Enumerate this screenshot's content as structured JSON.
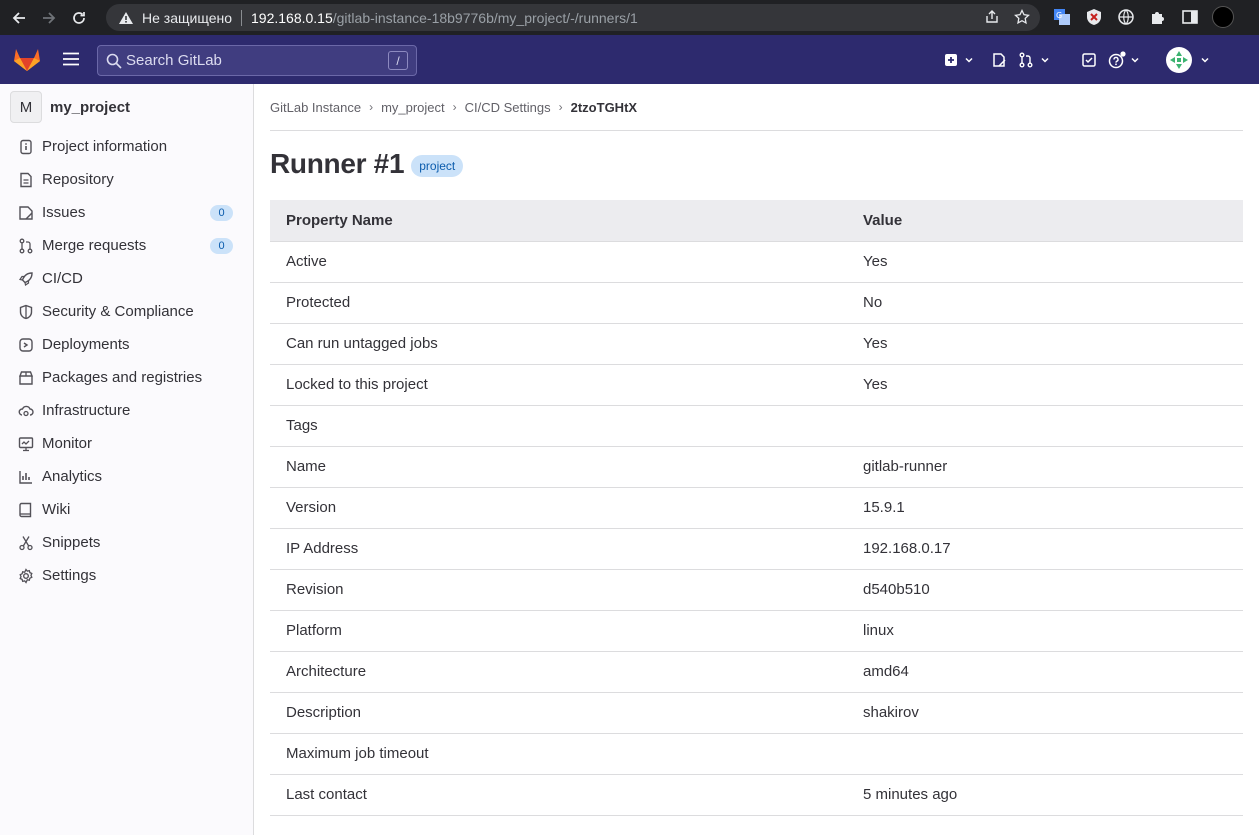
{
  "browser": {
    "not_secure": "Не защищено",
    "url_host": "192.168.0.15",
    "url_path": "/gitlab-instance-18b9776b/my_project/-/runners/1"
  },
  "header": {
    "search_placeholder": "Search GitLab",
    "search_shortcut": "/"
  },
  "sidebar": {
    "project_initial": "M",
    "project_name": "my_project",
    "items": [
      {
        "label": "Project information",
        "icon": "info-icon"
      },
      {
        "label": "Repository",
        "icon": "document-icon"
      },
      {
        "label": "Issues",
        "icon": "issues-icon",
        "count": "0"
      },
      {
        "label": "Merge requests",
        "icon": "merge-request-icon",
        "count": "0"
      },
      {
        "label": "CI/CD",
        "icon": "rocket-icon"
      },
      {
        "label": "Security & Compliance",
        "icon": "shield-icon"
      },
      {
        "label": "Deployments",
        "icon": "deployments-icon"
      },
      {
        "label": "Packages and registries",
        "icon": "package-icon"
      },
      {
        "label": "Infrastructure",
        "icon": "cloud-gear-icon"
      },
      {
        "label": "Monitor",
        "icon": "monitor-icon"
      },
      {
        "label": "Analytics",
        "icon": "chart-icon"
      },
      {
        "label": "Wiki",
        "icon": "book-icon"
      },
      {
        "label": "Snippets",
        "icon": "snippet-icon"
      },
      {
        "label": "Settings",
        "icon": "settings-icon"
      }
    ]
  },
  "breadcrumb": [
    "GitLab Instance",
    "my_project",
    "CI/CD Settings",
    "2tzoTGHtX"
  ],
  "page": {
    "title": "Runner #1",
    "badge": "project"
  },
  "table": {
    "headers": [
      "Property Name",
      "Value"
    ],
    "rows": [
      [
        "Active",
        "Yes"
      ],
      [
        "Protected",
        "No"
      ],
      [
        "Can run untagged jobs",
        "Yes"
      ],
      [
        "Locked to this project",
        "Yes"
      ],
      [
        "Tags",
        ""
      ],
      [
        "Name",
        "gitlab-runner"
      ],
      [
        "Version",
        "15.9.1"
      ],
      [
        "IP Address",
        "192.168.0.17"
      ],
      [
        "Revision",
        "d540b510"
      ],
      [
        "Platform",
        "linux"
      ],
      [
        "Architecture",
        "amd64"
      ],
      [
        "Description",
        "shakirov"
      ],
      [
        "Maximum job timeout",
        ""
      ],
      [
        "Last contact",
        "5 minutes ago"
      ]
    ]
  }
}
